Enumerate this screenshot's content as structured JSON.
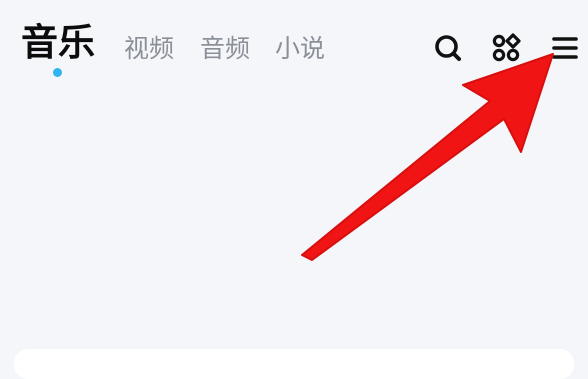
{
  "header": {
    "tabs": [
      {
        "label": "音乐",
        "active": true
      },
      {
        "label": "视频",
        "active": false
      },
      {
        "label": "音频",
        "active": false
      },
      {
        "label": "小说",
        "active": false
      }
    ],
    "actions": [
      {
        "icon": "search-icon"
      },
      {
        "icon": "apps-grid-icon"
      },
      {
        "icon": "menu-icon"
      }
    ]
  },
  "colors": {
    "background": "#f5f6fa",
    "active_tab": "#0c0c0c",
    "inactive_tab": "#8b8f98",
    "indicator": "#2fb4f0",
    "annotation_arrow": "#f01414"
  }
}
